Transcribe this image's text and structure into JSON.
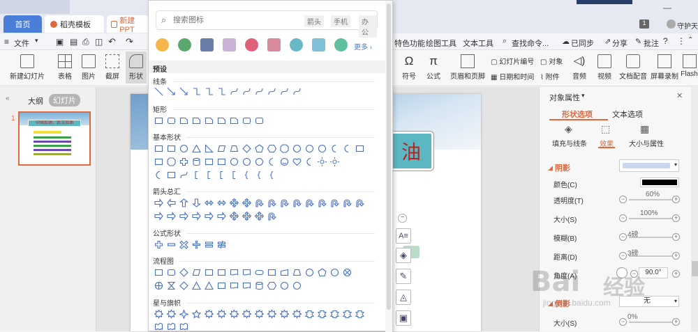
{
  "tabs": {
    "home": "首页",
    "template": "稻壳模板",
    "new_ppt": "新建 PPT"
  },
  "title_right": {
    "page_num": "1",
    "user": "守护天使"
  },
  "menu": {
    "file": "文件",
    "special": "特色功能",
    "drawing": "绘图工具",
    "text_tools": "文本工具",
    "search": "查找命令...",
    "sync": "已同步",
    "share": "分享",
    "annotate": "批注"
  },
  "ribbon": {
    "new_slide": "新建幻灯片",
    "table": "表格",
    "picture": "图片",
    "screenshot": "截屏",
    "shape": "形状",
    "symbol": "符号",
    "formula": "公式",
    "header_footer": "页眉和页脚",
    "slide_number": "幻灯片编号",
    "object": "对象",
    "datetime": "日期和时间",
    "attachment": "附件",
    "audio": "音频",
    "video": "视频",
    "voiceover": "文档配音",
    "screen_record": "屏幕录制",
    "flash": "Flash"
  },
  "leftpane": {
    "outline": "大纲",
    "slides": "幻灯片",
    "slide_index": "1"
  },
  "slide": {
    "title_char": "油"
  },
  "thumb": {
    "title": "中国加油，武汉加油"
  },
  "shape_panel": {
    "search_placeholder": "搜索图标",
    "search_tags": [
      "箭头",
      "手机",
      "办公"
    ],
    "more": "更多",
    "preset": "预设",
    "sections": [
      "线条",
      "矩形",
      "基本形状",
      "箭头总汇",
      "公式形状",
      "流程图",
      "星与旗帜"
    ]
  },
  "props": {
    "title": "对象属性",
    "tab_shape": "形状选项",
    "tab_text": "文本选项",
    "sub_fill": "填充与线条",
    "sub_effect": "效果",
    "sub_size": "大小与属性",
    "shadow": "阴影",
    "color": "颜色(C)",
    "transparency": "透明度(T)",
    "size": "大小(S)",
    "blur": "模糊(B)",
    "distance": "距离(D)",
    "angle": "角度(A)",
    "reflection": "倒影",
    "reflection_val": "无",
    "ref_size": "大小(S)",
    "transparency_val": "60%",
    "size_val": "100%",
    "blur_val": "4磅",
    "distance_val": "3磅",
    "angle_val": "90.0°",
    "ref_size_val": "0%"
  },
  "watermark": {
    "brand": "Bai",
    "site": "jingyan.baidu.com",
    "cn": "经验"
  },
  "colors": {
    "accent": "#e0683c",
    "tab_blue": "#4a7ed9",
    "shape_stroke": "#4a6fbf",
    "slide_title_bg": "#5bb8c2"
  }
}
